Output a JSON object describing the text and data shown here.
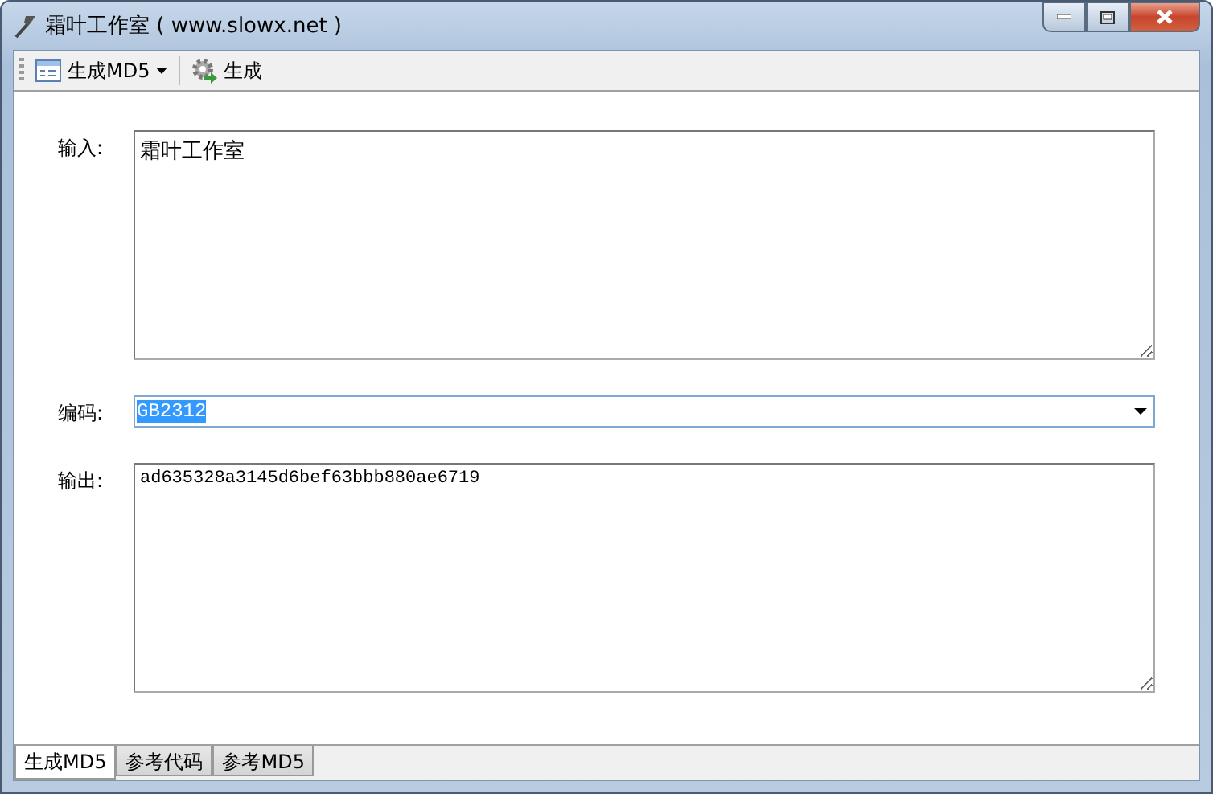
{
  "window": {
    "title": "霜叶工作室 ( www.slowx.net )"
  },
  "toolbar": [
    {
      "kind": "dropdown",
      "label": "生成MD5"
    },
    {
      "kind": "button",
      "label": "生成"
    }
  ],
  "fields": [
    {
      "kind": "textarea",
      "label": "输入:",
      "value": "霜叶工作室"
    },
    {
      "kind": "combo",
      "label": "编码:",
      "value": "GB2312",
      "highlighted": true
    },
    {
      "kind": "output",
      "label": "输出:",
      "value": "ad635328a3145d6bef63bbb880ae6719"
    }
  ],
  "tabs": [
    {
      "label": "生成MD5",
      "selected": true
    },
    {
      "label": "参考代码",
      "selected": false
    },
    {
      "label": "参考MD5",
      "selected": false
    }
  ]
}
